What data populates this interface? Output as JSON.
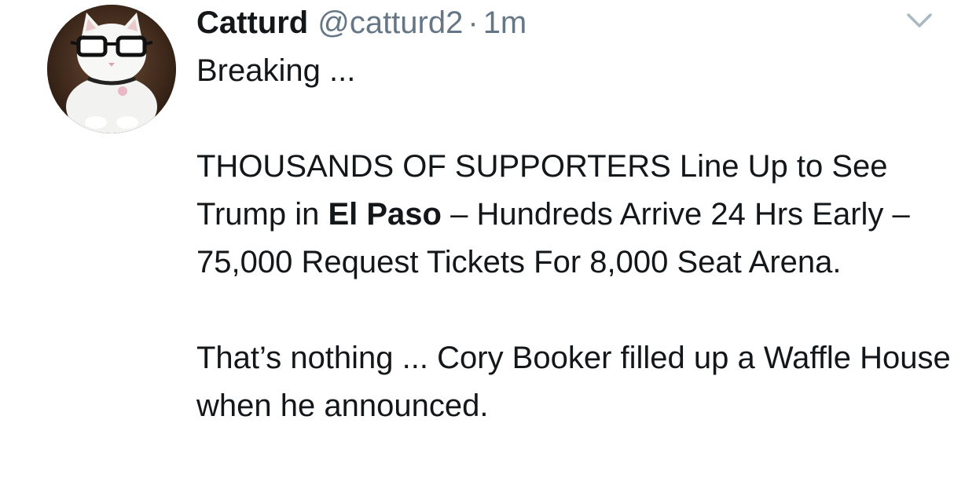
{
  "tweet": {
    "author": {
      "display_name": "Catturd",
      "handle": "@catturd2",
      "separator": "·",
      "timestamp": "1m",
      "avatar_icon": "cat-with-glasses-avatar"
    },
    "menu_icon": "chevron-down-icon",
    "text": {
      "line1": "Breaking ...",
      "para2_before": "THOUSANDS OF SUPPORTERS Line Up to See Trump in ",
      "para2_bold": "El Paso",
      "para2_after": " – Hundreds Arrive 24 Hrs Early – 75,000 Request Tickets For 8,000 Seat Arena.",
      "para3": "That’s nothing ... Cory Booker filled up a Waffle House when he announced."
    }
  },
  "colors": {
    "text": "#14171a",
    "secondary": "#657786",
    "chevron": "#aab8c2"
  }
}
